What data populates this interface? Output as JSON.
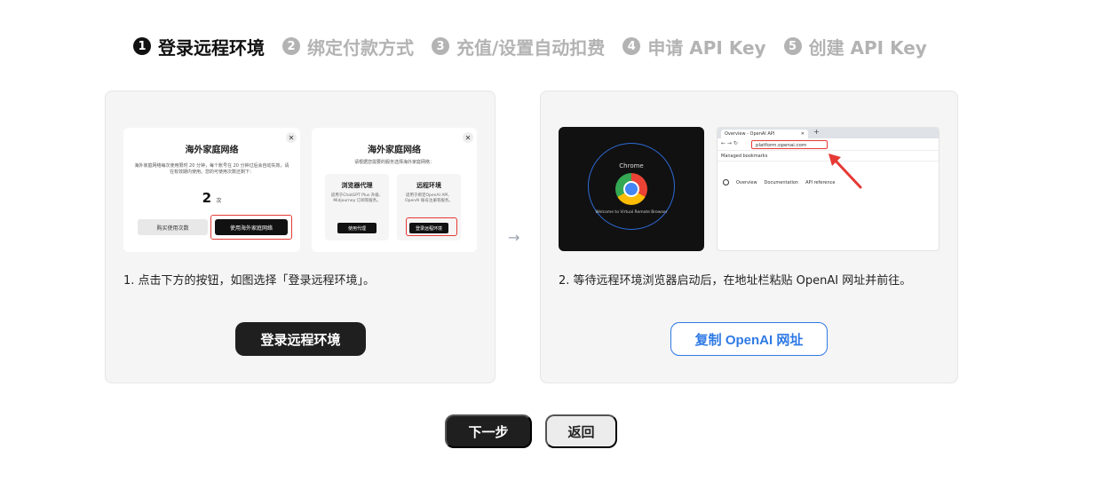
{
  "steps": [
    {
      "num": "1",
      "label": "登录远程环境",
      "active": true
    },
    {
      "num": "2",
      "label": "绑定付款方式",
      "active": false
    },
    {
      "num": "3",
      "label": "充值/设置自动扣费",
      "active": false
    },
    {
      "num": "4",
      "label": "申请 API Key",
      "active": false
    },
    {
      "num": "5",
      "label": "创建 API Key",
      "active": false
    }
  ],
  "left_panel": {
    "dialog1": {
      "title": "海外家庭网络",
      "text": "海外家庭网络每次使用限时 20 分钟，每个账号在 20 分钟过后会自动失效，请在有效期内使用。您的可使用次数还剩下：",
      "count": "2",
      "count_unit": "次",
      "buy_label": "购买使用次数",
      "use_label": "使用海外家庭网络"
    },
    "dialog2": {
      "title": "海外家庭网络",
      "subtitle": "请根据您需要的服务选择海外家庭网络：",
      "option1_title": "浏览器代理",
      "option1_desc": "适用于ChatGPT Plus 升级、Midjourney 订阅等服务。",
      "option1_btn": "使用代理",
      "option2_title": "远程环境",
      "option2_desc": "适用于绑定OpenAI API、OpenAI 账号注册等服务。",
      "option2_btn": "登录远程环境"
    },
    "description": "1. 点击下方的按钮，如图选择「登录远程环境」。",
    "button_label": "登录远程环境"
  },
  "right_panel": {
    "chrome_word": "Chrome",
    "chrome_welcome": "Welcome to Virtual Remote Browser",
    "browser_tab": "Overview - OpenAI API",
    "browser_url": "platform.openai.com",
    "bookmarks": "Managed bookmarks",
    "links": [
      "Overview",
      "Documentation",
      "API reference"
    ],
    "description": "2. 等待远程环境浏览器启动后，在地址栏粘贴 OpenAI 网址并前往。",
    "button_label": "复制 OpenAI 网址"
  },
  "footer": {
    "next_label": "下一步",
    "back_label": "返回"
  },
  "colors": {
    "accent": "#2f7ae5",
    "dark": "#1f1f1f",
    "highlight": "#e53935"
  }
}
